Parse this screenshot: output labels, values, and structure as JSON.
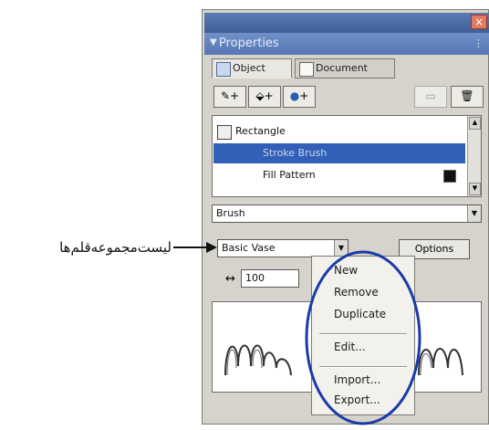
{
  "panel": {
    "title": "Properties",
    "tabs": [
      {
        "label": "Object",
        "icon": "object-icon"
      },
      {
        "label": "Document",
        "icon": "document-icon"
      }
    ],
    "toolbar": [
      {
        "icon": "pencil-icon",
        "label": "+"
      },
      {
        "icon": "paint-bucket-icon",
        "label": "+"
      },
      {
        "icon": "effect-icon",
        "label": "+"
      },
      {
        "icon": "duplicate-attribute-icon",
        "label": ""
      },
      {
        "icon": "trash-icon",
        "label": ""
      }
    ],
    "attributes": [
      {
        "label": "Rectangle",
        "selected": false
      },
      {
        "label": "Stroke Brush",
        "selected": true
      },
      {
        "label": "Fill Pattern",
        "selected": false
      }
    ],
    "brush_type": "Brush",
    "brush_library": "Basic Vase",
    "options_label": "Options",
    "width_value": "100"
  },
  "context_menu": {
    "items": [
      "New",
      "Remove",
      "Duplicate",
      "Edit...",
      "Import...",
      "Export..."
    ]
  },
  "annotation": {
    "text": "لیست‌مجموعه‌قلم‌ها"
  },
  "colors": {
    "highlight": "#1a3aa8",
    "selection": "#3260b8"
  }
}
